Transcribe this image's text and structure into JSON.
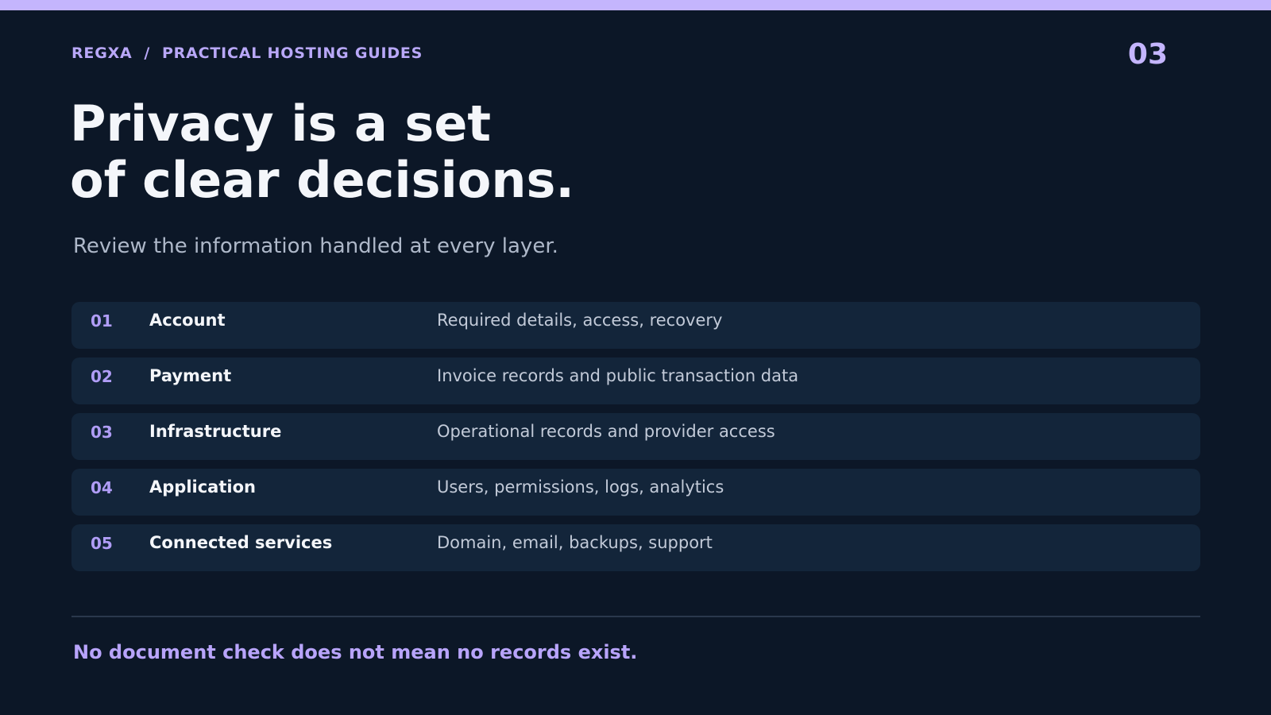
{
  "header": {
    "breadcrumb": "REGXA  /  PRACTICAL HOSTING GUIDES",
    "slide_number": "03"
  },
  "hero": {
    "title_line1": "Privacy is a set",
    "title_line2": "of clear decisions.",
    "subtitle": "Review the information handled at every layer."
  },
  "layers": [
    {
      "num": "01",
      "name": "Account",
      "desc": "Required details, access, recovery"
    },
    {
      "num": "02",
      "name": "Payment",
      "desc": "Invoice records and public transaction data"
    },
    {
      "num": "03",
      "name": "Infrastructure",
      "desc": "Operational records and provider access"
    },
    {
      "num": "04",
      "name": "Application",
      "desc": "Users, permissions, logs, analytics"
    },
    {
      "num": "05",
      "name": "Connected services",
      "desc": "Domain, email, backups, support"
    }
  ],
  "footer": {
    "note": "No document check does not mean no records exist."
  },
  "colors": {
    "background": "#0c1727",
    "accent": "#c4b5fd",
    "row_background": "#13253a",
    "title": "#f4f6fa",
    "muted_text": "#aeb8c9"
  }
}
